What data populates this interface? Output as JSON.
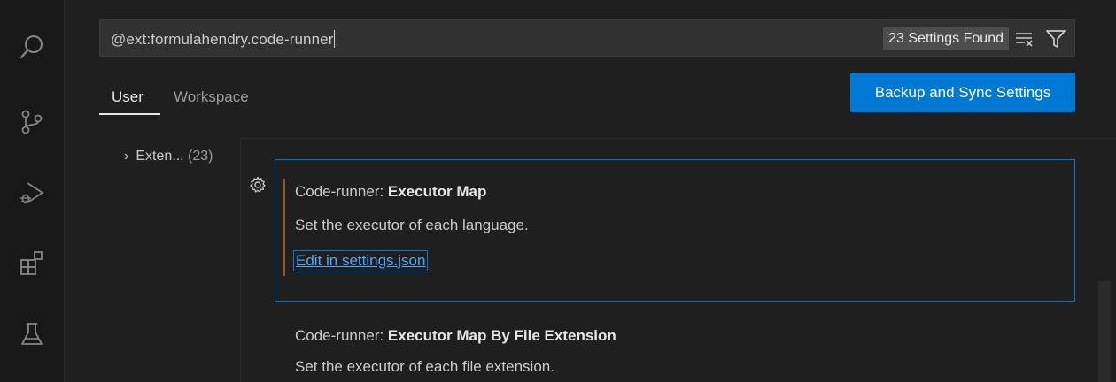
{
  "search": {
    "query": "@ext:formulahendry.code-runner",
    "found_badge": "23 Settings Found"
  },
  "tabs": [
    {
      "label": "User",
      "active": true
    },
    {
      "label": "Workspace",
      "active": false
    }
  ],
  "sync_button": "Backup and Sync Settings",
  "toc": {
    "label": "Exten...",
    "count": "(23)"
  },
  "settings": [
    {
      "category": "Code-runner: ",
      "name": "Executor Map",
      "description": "Set the executor of each language.",
      "link": "Edit in settings.json"
    },
    {
      "category": "Code-runner: ",
      "name": "Executor Map By File Extension",
      "description": "Set the executor of each file extension."
    }
  ],
  "activity_bar": {
    "icons": [
      "search-icon",
      "source-control-icon",
      "run-debug-icon",
      "extensions-icon",
      "testing-icon"
    ]
  },
  "colors": {
    "accent": "#0078d4",
    "link": "#4daafc",
    "modified": "#8b5a2b",
    "background": "#1f1f1f"
  }
}
